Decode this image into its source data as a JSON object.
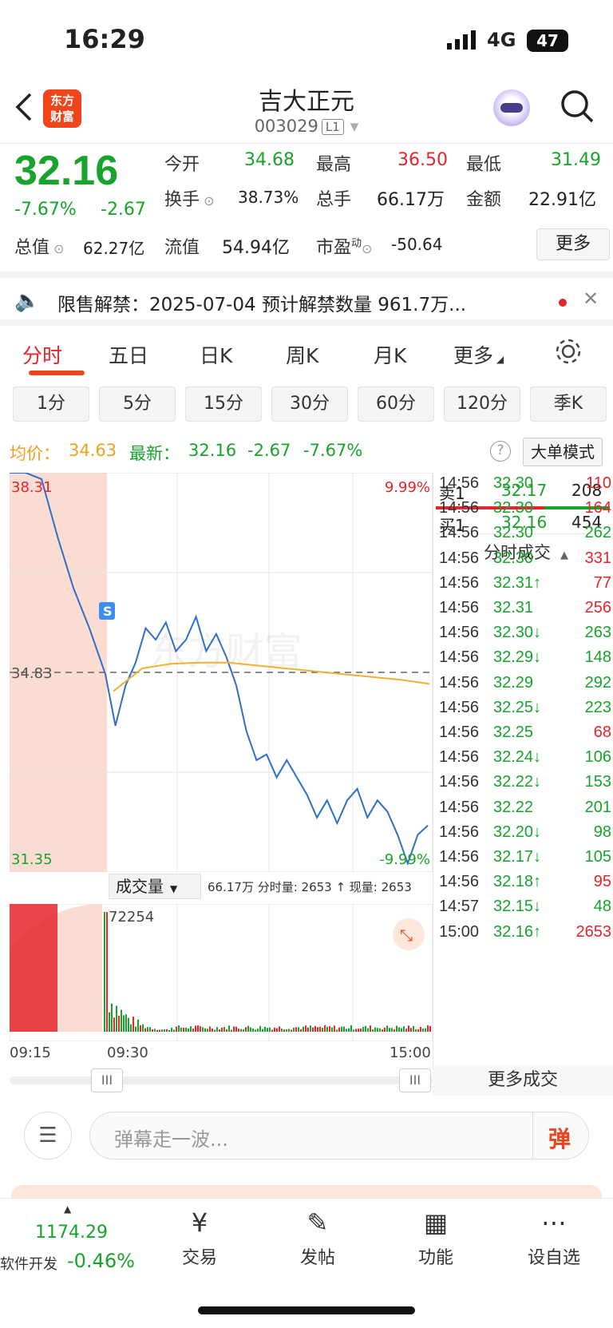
{
  "status": {
    "time": "16:29",
    "network": "4G",
    "battery": "47"
  },
  "header": {
    "back_icon": "chevron-left-icon",
    "logo_line1": "东方",
    "logo_line2": "财富",
    "title": "吉大正元",
    "code": "003029",
    "level": "L1"
  },
  "quote": {
    "price": "32.16",
    "change_pct": "-7.67%",
    "change": "-2.67",
    "open_label": "今开",
    "open": "34.68",
    "high_label": "最高",
    "high": "36.50",
    "low_label": "最低",
    "low": "31.49",
    "turnover_label": "换手",
    "turnover": "38.73%",
    "volume_label": "总手",
    "volume": "66.17万",
    "amount_label": "金额",
    "amount": "22.91亿",
    "mcap_label": "总值",
    "mcap": "62.27亿",
    "float_label": "流值",
    "float": "54.94亿",
    "pe_label": "市盈",
    "pe_sup": "动",
    "pe": "-50.64",
    "more": "更多"
  },
  "notice": {
    "text": "限售解禁：2025-07-04 预计解禁数量 961.7万..."
  },
  "tabs": [
    "分时",
    "五日",
    "日K",
    "周K",
    "月K",
    "更多"
  ],
  "periods": [
    "1分",
    "5分",
    "15分",
    "30分",
    "60分",
    "120分",
    "季K"
  ],
  "info": {
    "avg_label": "均价：",
    "avg": "34.63",
    "last_label": "最新：",
    "last": "32.16",
    "chg": "-2.67",
    "pct": "-7.67%",
    "mode": "大单模式"
  },
  "chart_data": {
    "type": "line",
    "title": "",
    "price_high_label": "38.31",
    "price_mid_label": "34.83",
    "price_low_label": "31.35",
    "pct_high_label": "9.99%",
    "pct_low_label": "-9.99%",
    "ylim": [
      31.35,
      38.31
    ],
    "x_labels": [
      "09:15",
      "09:30",
      "15:00"
    ],
    "volume_label": "成交量",
    "volume_info": "66.17万 分时量: 2653 ↑ 现量: 2653",
    "volume_max": "72254",
    "price_series": [
      38.31,
      38.31,
      38.2,
      37.2,
      36.3,
      35.6,
      34.8,
      33.9,
      34.6,
      35.0,
      35.6,
      35.4,
      35.7,
      35.2,
      35.4,
      35.8,
      35.2,
      35.5,
      35.1,
      34.6,
      33.8,
      33.3,
      33.4,
      33.0,
      33.3,
      33.0,
      32.7,
      32.3,
      32.6,
      32.2,
      32.6,
      32.8,
      32.3,
      32.6,
      32.4,
      32.0,
      31.5,
      32.0,
      32.16
    ],
    "avg_series": [
      34.5,
      34.9,
      34.98,
      35.0,
      35.0,
      34.95,
      34.9,
      34.85,
      34.8,
      34.75,
      34.7,
      34.63
    ]
  },
  "book": {
    "sell_label": "卖1",
    "sell_price": "32.17",
    "sell_vol": "208",
    "buy_label": "买1",
    "buy_price": "32.16",
    "buy_vol": "454",
    "ticks_title": "分时成交",
    "more": "更多成交"
  },
  "ticks": [
    {
      "t": "14:56",
      "p": "32.30",
      "v": "110",
      "c": "red"
    },
    {
      "t": "14:56",
      "p": "32.30",
      "v": "164",
      "c": "red"
    },
    {
      "t": "14:56",
      "p": "32.30",
      "v": "262",
      "c": "green"
    },
    {
      "t": "14:56",
      "p": "32.30",
      "v": "331",
      "c": "red"
    },
    {
      "t": "14:56",
      "p": "32.31↑",
      "v": "77",
      "c": "red"
    },
    {
      "t": "14:56",
      "p": "32.31",
      "v": "256",
      "c": "red"
    },
    {
      "t": "14:56",
      "p": "32.30↓",
      "v": "263",
      "c": "green"
    },
    {
      "t": "14:56",
      "p": "32.29↓",
      "v": "148",
      "c": "green"
    },
    {
      "t": "14:56",
      "p": "32.29",
      "v": "292",
      "c": "green"
    },
    {
      "t": "14:56",
      "p": "32.25↓",
      "v": "223",
      "c": "green"
    },
    {
      "t": "14:56",
      "p": "32.25",
      "v": "68",
      "c": "red"
    },
    {
      "t": "14:56",
      "p": "32.24↓",
      "v": "106",
      "c": "green"
    },
    {
      "t": "14:56",
      "p": "32.22↓",
      "v": "153",
      "c": "green"
    },
    {
      "t": "14:56",
      "p": "32.22",
      "v": "201",
      "c": "green"
    },
    {
      "t": "14:56",
      "p": "32.20↓",
      "v": "98",
      "c": "green"
    },
    {
      "t": "14:56",
      "p": "32.17↓",
      "v": "105",
      "c": "green"
    },
    {
      "t": "14:56",
      "p": "32.18↑",
      "v": "95",
      "c": "red"
    },
    {
      "t": "14:57",
      "p": "32.15↓",
      "v": "48",
      "c": "green"
    },
    {
      "t": "15:00",
      "p": "32.16↑",
      "v": "2653",
      "c": "red"
    }
  ],
  "danmu": {
    "placeholder": "弹幕走一波...",
    "btn": "弹"
  },
  "bottom": {
    "index_value": "1174.29",
    "index_name": "软件开发",
    "index_pct": "-0.46%",
    "trade": "交易",
    "post": "发帖",
    "func": "功能",
    "watch": "设自选"
  }
}
